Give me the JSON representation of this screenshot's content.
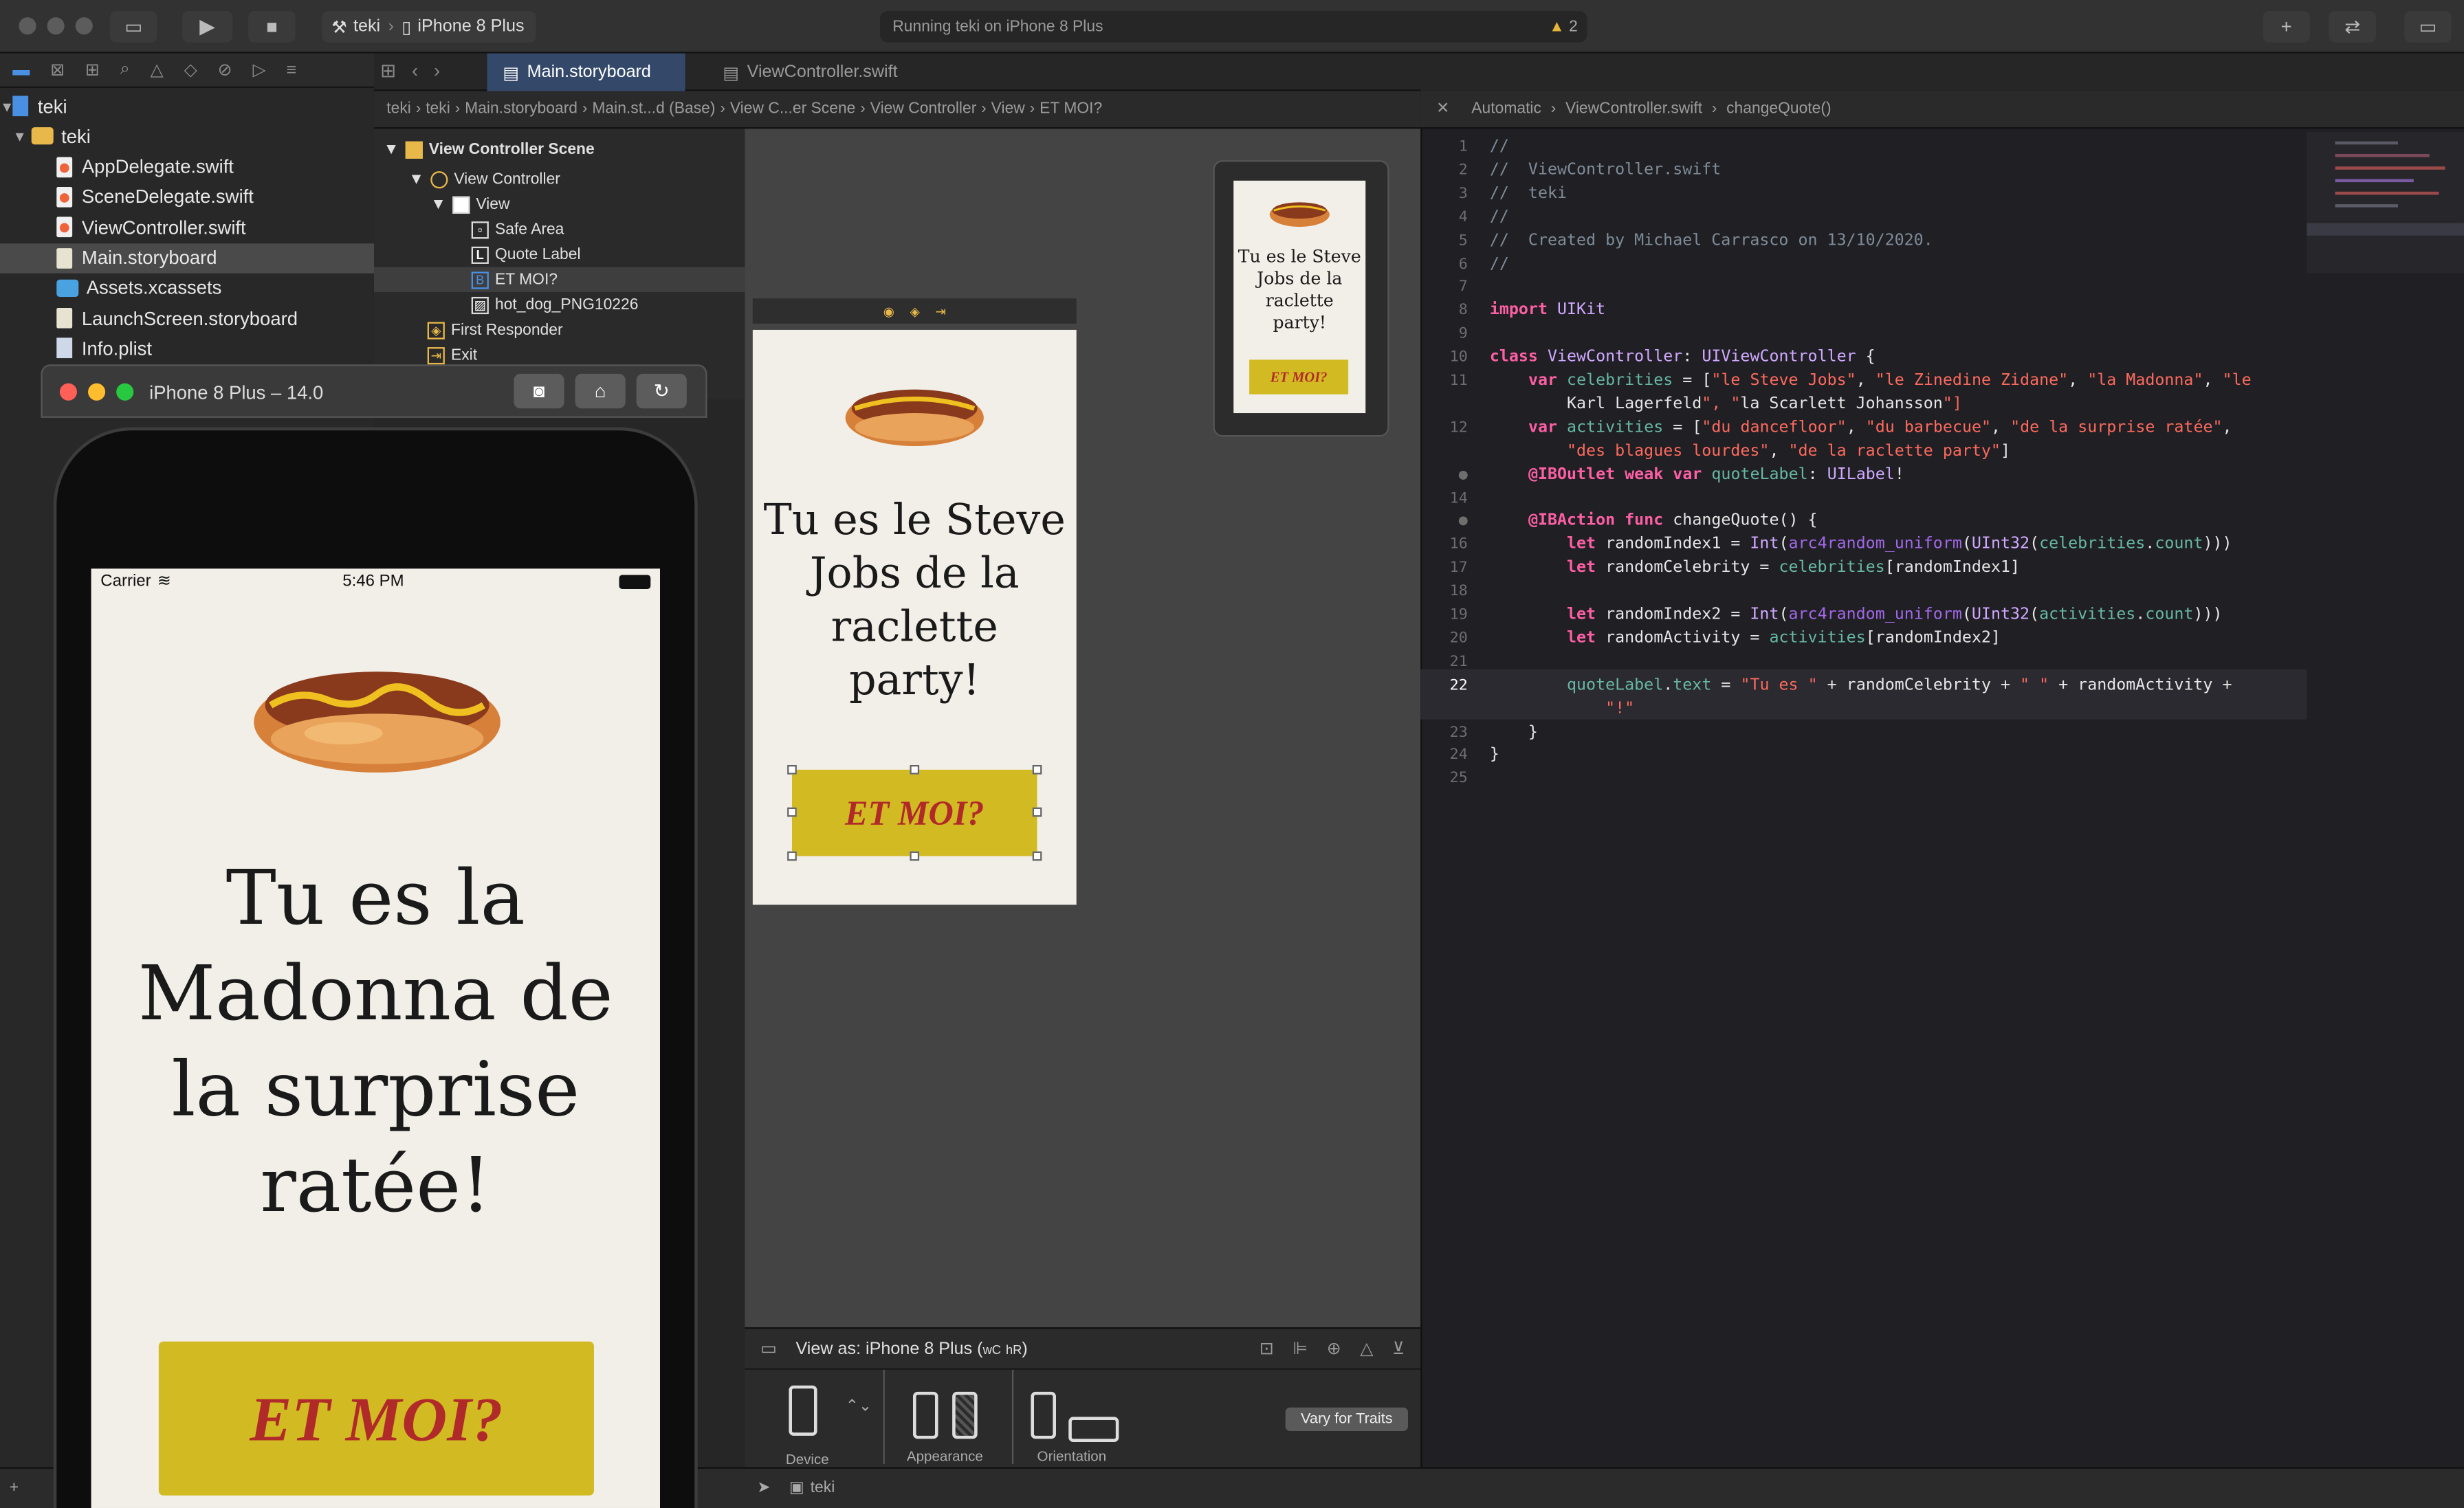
{
  "toolbar": {
    "scheme": "teki",
    "device": "iPhone 8 Plus",
    "status": "Running teki on iPhone 8 Plus",
    "warnings": "2"
  },
  "navigator": {
    "items": [
      {
        "label": "teki",
        "kind": "project"
      },
      {
        "label": "teki",
        "kind": "folder"
      },
      {
        "label": "AppDelegate.swift",
        "kind": "swift"
      },
      {
        "label": "SceneDelegate.swift",
        "kind": "swift"
      },
      {
        "label": "ViewController.swift",
        "kind": "swift"
      },
      {
        "label": "Main.storyboard",
        "kind": "storyboard",
        "selected": true
      },
      {
        "label": "Assets.xcassets",
        "kind": "assets"
      },
      {
        "label": "LaunchScreen.storyboard",
        "kind": "storyboard"
      },
      {
        "label": "Info.plist",
        "kind": "plist"
      }
    ]
  },
  "tabs": [
    "Main.storyboard",
    "ViewController.swift"
  ],
  "jumpbar": [
    "teki",
    "teki",
    "Main.storyboard",
    "Main.st...d (Base)",
    "View C...er Scene",
    "View Controller",
    "View",
    "ET MOI?"
  ],
  "outline": {
    "scene": "View Controller Scene",
    "controller": "View Controller",
    "view": "View",
    "safe_area": "Safe Area",
    "quote_label": "Quote Label",
    "button": "ET MOI?",
    "image": "hot_dog_PNG10226",
    "first_responder": "First Responder",
    "exit": "Exit"
  },
  "simulator": {
    "title": "iPhone 8 Plus – 14.0",
    "carrier": "Carrier",
    "time": "5:46 PM",
    "quote": "Tu es la Madonna de la surprise ratée!",
    "button": "ET MOI?"
  },
  "storyboard": {
    "quote": "Tu es le Steve Jobs de la raclette party!",
    "button": "ET MOI?"
  },
  "preview": {
    "quote": "Tu es le Steve Jobs de la raclette party!",
    "button": "ET MOI?"
  },
  "view_as": {
    "label": "View as: iPhone 8 Plus (",
    "wc": "wC",
    "hr": "hR",
    "close": ")",
    "device": "Device",
    "appearance": "Appearance",
    "orientation": "Orientation",
    "vary": "Vary for Traits"
  },
  "editor_jump": [
    "Automatic",
    "ViewController.swift",
    "changeQuote()"
  ],
  "bottom": {
    "target": "teki"
  },
  "code": [
    {
      "n": "1",
      "t": "//"
    },
    {
      "n": "2",
      "t": "//  ViewController.swift"
    },
    {
      "n": "3",
      "t": "//  teki"
    },
    {
      "n": "4",
      "t": "//"
    },
    {
      "n": "5",
      "t": "//  Created by Michael Carrasco on 13/10/2020."
    },
    {
      "n": "6",
      "t": "//"
    },
    {
      "n": "7",
      "t": ""
    },
    {
      "n": "8",
      "t": "import UIKit"
    },
    {
      "n": "9",
      "t": ""
    },
    {
      "n": "10",
      "t": "class ViewController: UIViewController {"
    },
    {
      "n": "11",
      "t": "    var celebrities = [\"le Steve Jobs\", \"le Zinedine Zidane\", \"la Madonna\", \"le"
    },
    {
      "n": "",
      "t": "        Karl Lagerfeld\", \"la Scarlett Johansson\"]"
    },
    {
      "n": "12",
      "t": "    var activities = [\"du dancefloor\", \"du barbecue\", \"de la surprise ratée\","
    },
    {
      "n": "",
      "t": "        \"des blagues lourdes\", \"de la raclette party\"]"
    },
    {
      "n": "●",
      "t": "    @IBOutlet weak var quoteLabel: UILabel!"
    },
    {
      "n": "14",
      "t": ""
    },
    {
      "n": "●",
      "t": "    @IBAction func changeQuote() {"
    },
    {
      "n": "16",
      "t": "        let randomIndex1 = Int(arc4random_uniform(UInt32(celebrities.count)))"
    },
    {
      "n": "17",
      "t": "        let randomCelebrity = celebrities[randomIndex1]"
    },
    {
      "n": "18",
      "t": ""
    },
    {
      "n": "19",
      "t": "        let randomIndex2 = Int(arc4random_uniform(UInt32(activities.count)))"
    },
    {
      "n": "20",
      "t": "        let randomActivity = activities[randomIndex2]"
    },
    {
      "n": "21",
      "t": ""
    },
    {
      "n": "22",
      "t": "        quoteLabel.text = \"Tu es \" + randomCelebrity + \" \" + randomActivity +"
    },
    {
      "n": "",
      "t": "            \"!\""
    },
    {
      "n": "23",
      "t": "    }"
    },
    {
      "n": "24",
      "t": "}"
    },
    {
      "n": "25",
      "t": ""
    }
  ]
}
